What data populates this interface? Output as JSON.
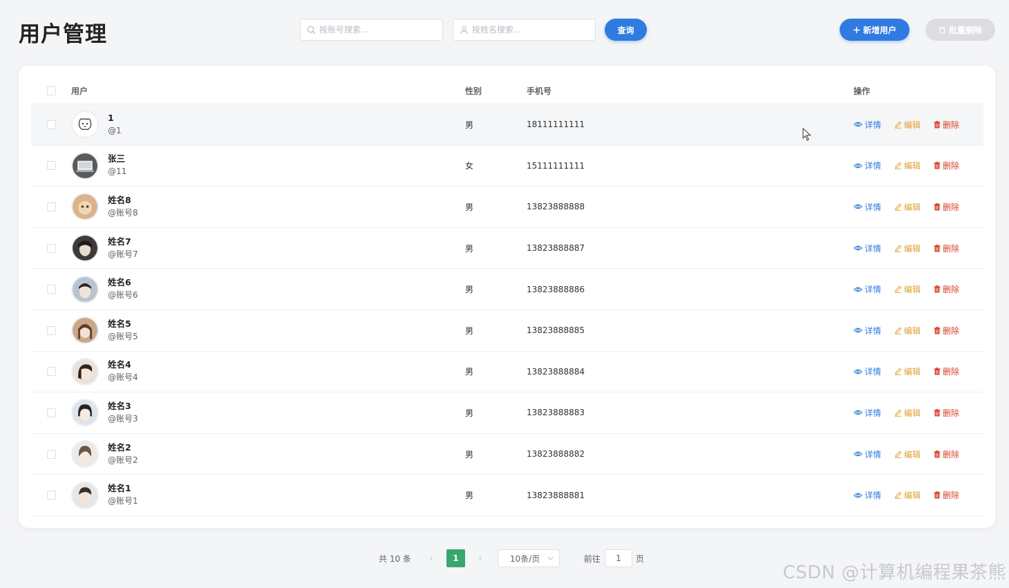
{
  "page": {
    "title": "用户管理"
  },
  "search": {
    "account_placeholder": "按账号搜索...",
    "name_placeholder": "按姓名搜索...",
    "query_label": "查询"
  },
  "toolbar": {
    "add_label": "新增用户",
    "batch_delete_label": "批量删除"
  },
  "table": {
    "headers": {
      "user": "用户",
      "sex": "性别",
      "phone": "手机号",
      "ops": "操作"
    },
    "ops": {
      "detail": "详情",
      "edit": "编辑",
      "delete": "删除"
    },
    "rows": [
      {
        "name": "1",
        "account": "@1",
        "sex": "男",
        "phone": "18111111111"
      },
      {
        "name": "张三",
        "account": "@11",
        "sex": "女",
        "phone": "15111111111"
      },
      {
        "name": "姓名8",
        "account": "@账号8",
        "sex": "男",
        "phone": "13823888888"
      },
      {
        "name": "姓名7",
        "account": "@账号7",
        "sex": "男",
        "phone": "13823888887"
      },
      {
        "name": "姓名6",
        "account": "@账号6",
        "sex": "男",
        "phone": "13823888886"
      },
      {
        "name": "姓名5",
        "account": "@账号5",
        "sex": "男",
        "phone": "13823888885"
      },
      {
        "name": "姓名4",
        "account": "@账号4",
        "sex": "男",
        "phone": "13823888884"
      },
      {
        "name": "姓名3",
        "account": "@账号3",
        "sex": "男",
        "phone": "13823888883"
      },
      {
        "name": "姓名2",
        "account": "@账号2",
        "sex": "男",
        "phone": "13823888882"
      },
      {
        "name": "姓名1",
        "account": "@账号1",
        "sex": "男",
        "phone": "13823888881"
      }
    ]
  },
  "pagination": {
    "total": "共 10 条",
    "current_page": "1",
    "page_size": "10条/页",
    "goto_label": "前往",
    "goto_value": "1",
    "page_suffix": "页"
  },
  "watermark": "CSDN @计算机编程果茶熊",
  "colors": {
    "primary": "#2f7be0",
    "edit": "#e0a030",
    "delete": "#d9442a",
    "active_page": "#3aa76d"
  }
}
